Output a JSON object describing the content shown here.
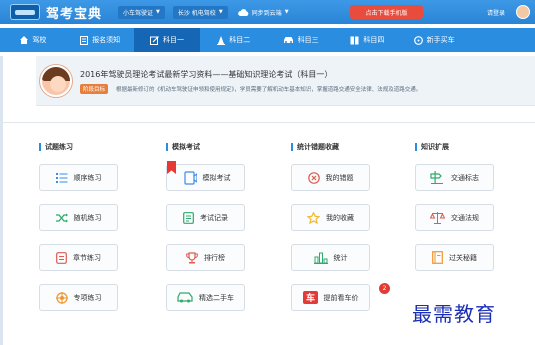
{
  "app": {
    "title": "驾考宝典",
    "car_type": "小车驾驶证",
    "region": "长沙 机电驾校",
    "sync_label": "同步到云端",
    "download_label": "点击下载手机版",
    "login_label": "请登录"
  },
  "nav": {
    "items": [
      {
        "label": "驾校",
        "icon": "home-icon"
      },
      {
        "label": "报名须知",
        "icon": "notice-icon"
      },
      {
        "label": "科目一",
        "icon": "edit-icon"
      },
      {
        "label": "科目二",
        "icon": "cone-icon"
      },
      {
        "label": "科目三",
        "icon": "car-icon"
      },
      {
        "label": "科目四",
        "icon": "book-icon"
      },
      {
        "label": "新手买车",
        "icon": "wheel-icon"
      }
    ],
    "active_index": 2
  },
  "banner": {
    "title": "2016年驾驶员理论考试最新学习资料——基础知识理论考试（科目一）",
    "goal_tag": "阶段目标",
    "goal_text": "根据最新修订的《机动车驾驶证申领和使用规定》，学员需要了解机动车基本知识，掌握道路交通安全法律、法规及道路交通。"
  },
  "sections": [
    {
      "heading": "试题练习",
      "buttons": [
        {
          "label": "顺序练习",
          "icon": "list-icon",
          "color": "#3a8ee6"
        },
        {
          "label": "随机练习",
          "icon": "shuffle-icon",
          "color": "#2eaa6a"
        },
        {
          "label": "章节练习",
          "icon": "chapter-icon",
          "color": "#e05a4f"
        },
        {
          "label": "专项练习",
          "icon": "target-icon",
          "color": "#f0962e"
        }
      ]
    },
    {
      "heading": "模拟考试",
      "buttons": [
        {
          "label": "模拟考试",
          "icon": "exam-icon",
          "color": "#3a8ee6"
        },
        {
          "label": "考试记录",
          "icon": "record-icon",
          "color": "#2eaa6a"
        },
        {
          "label": "排行榜",
          "icon": "trophy-icon",
          "color": "#e05a4f"
        },
        {
          "label": "精选二手车",
          "icon": "used-car-icon",
          "color": "#2eaa6a"
        }
      ]
    },
    {
      "heading": "统计错题收藏",
      "buttons": [
        {
          "label": "我的错题",
          "icon": "wrong-icon",
          "color": "#e05a4f"
        },
        {
          "label": "我的收藏",
          "icon": "star-icon",
          "color": "#f0b72e"
        },
        {
          "label": "统计",
          "icon": "stats-icon",
          "color": "#2eaa6a"
        },
        {
          "label": "提前看车价",
          "icon": "car-price-icon",
          "color": "#e53935",
          "badge": "2"
        }
      ]
    },
    {
      "heading": "知识扩展",
      "buttons": [
        {
          "label": "交通标志",
          "icon": "traffic-sign-icon",
          "color": "#2eaa6a"
        },
        {
          "label": "交通法规",
          "icon": "scale-icon",
          "color": "#e05a4f"
        },
        {
          "label": "过关秘籍",
          "icon": "secret-book-icon",
          "color": "#f0962e"
        }
      ]
    }
  ],
  "watermark": "最需教育"
}
